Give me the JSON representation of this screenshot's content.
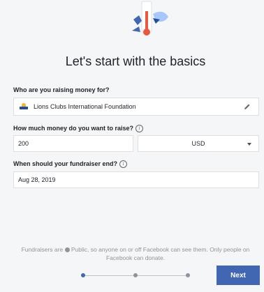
{
  "heading": "Let's start with the basics",
  "recipient": {
    "label": "Who are you raising money for?",
    "value": "Lions Clubs International Foundation"
  },
  "amount": {
    "label": "How much money do you want to raise?",
    "value": "200",
    "currency": "USD"
  },
  "end_date": {
    "label": "When should your fundraiser end?",
    "value": "Aug 28, 2019"
  },
  "footer": {
    "note_prefix": "Fundraisers are",
    "note_suffix": "Public, so anyone on or off Facebook can see them. Only people on Facebook can donate."
  },
  "progress": {
    "steps": 3,
    "current": 1
  },
  "next_label": "Next",
  "colors": {
    "primary": "#4267b2",
    "background": "#f5f6f7",
    "border": "#dddfe2"
  }
}
